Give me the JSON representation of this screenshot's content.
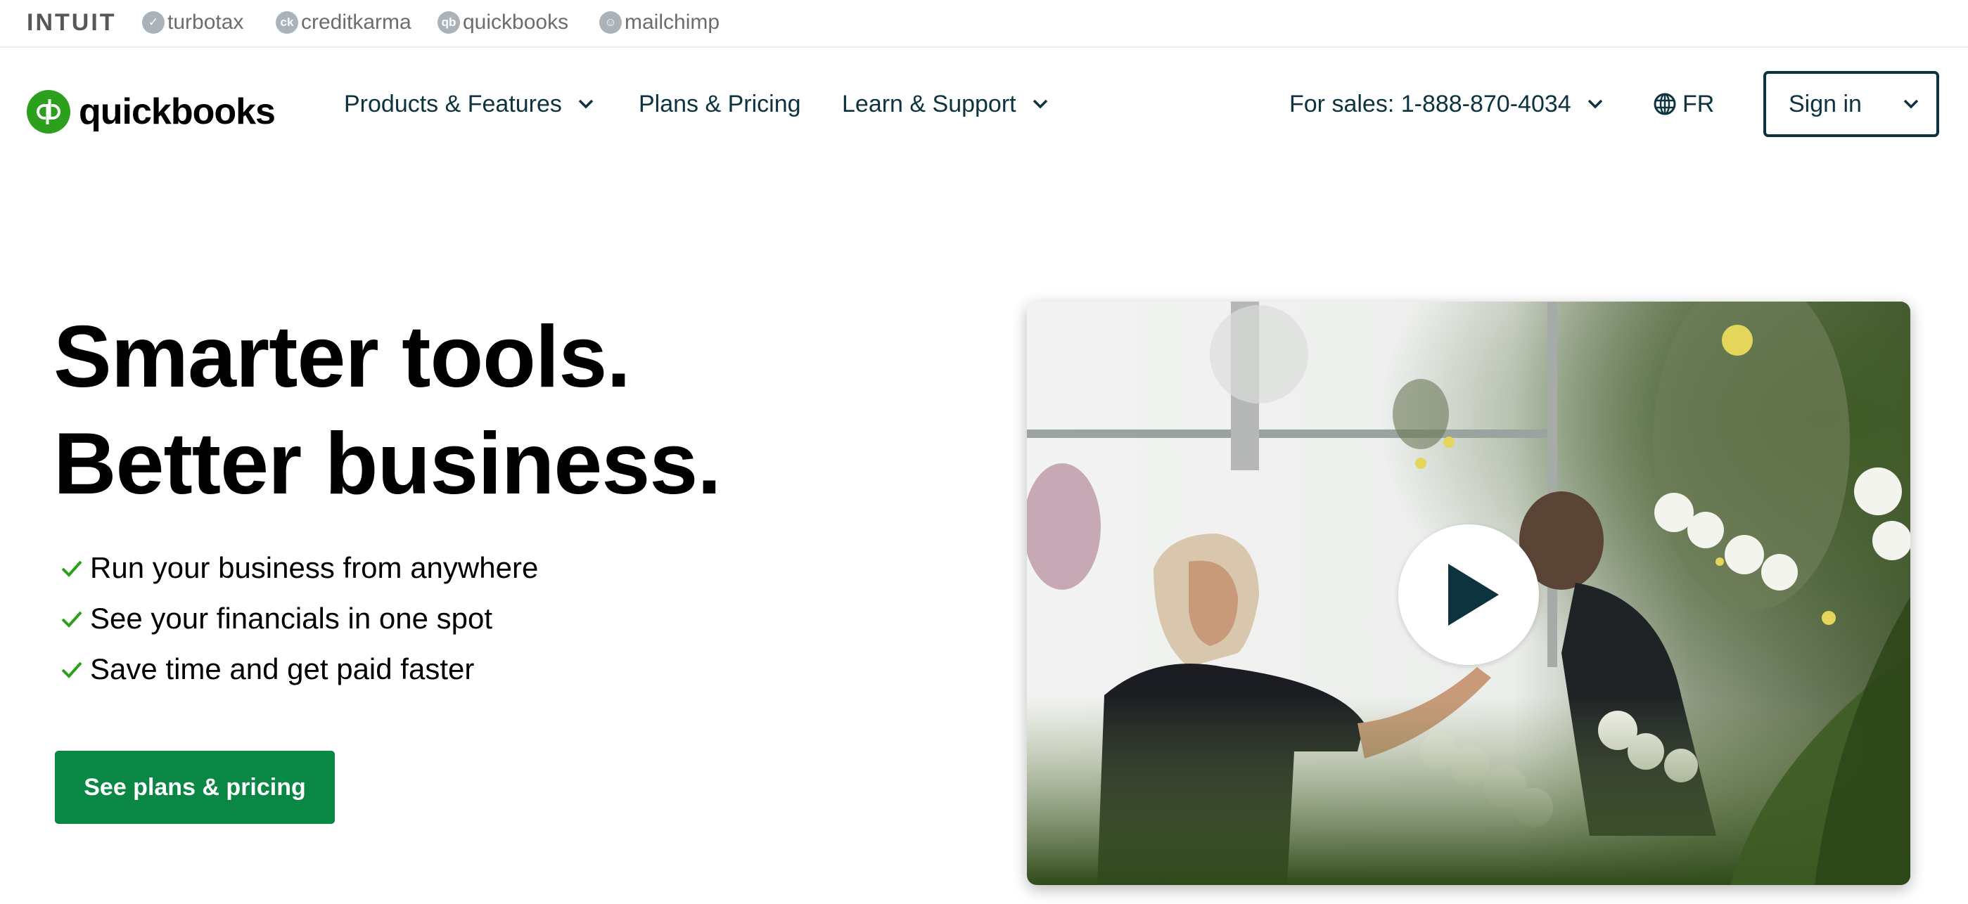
{
  "family_bar": {
    "brand": "INTUIT",
    "items": [
      {
        "label": "turbotax",
        "icon": "turbotax-check-icon",
        "glyph": "✓"
      },
      {
        "label": "creditkarma",
        "icon": "creditkarma-icon",
        "glyph": "ck"
      },
      {
        "label": "quickbooks",
        "icon": "quickbooks-icon",
        "glyph": "qb"
      },
      {
        "label": "mailchimp",
        "icon": "mailchimp-icon",
        "glyph": "☺"
      }
    ]
  },
  "header": {
    "logo_text": "quickbooks",
    "logo_glyph": "qb",
    "nav": [
      {
        "label": "Products & Features",
        "has_dropdown": true
      },
      {
        "label": "Plans & Pricing",
        "has_dropdown": false
      },
      {
        "label": "Learn & Support",
        "has_dropdown": true
      }
    ],
    "sales": {
      "label": "For sales: 1-888-870-4034",
      "has_dropdown": true
    },
    "language": {
      "label": "FR",
      "icon": "globe-icon"
    },
    "sign_in": {
      "label": "Sign in",
      "has_dropdown": true
    }
  },
  "hero": {
    "headline_line1": "Smarter tools.",
    "headline_line2": "Better business.",
    "benefits": [
      "Run your business from anywhere",
      "See your financials in one spot",
      "Save time and get paid faster"
    ],
    "cta_label": "See plans & pricing"
  },
  "video": {
    "description": "Greenhouse scene with two people tending orchids",
    "play_icon": "play-icon"
  },
  "colors": {
    "brand_green": "#2ca01c",
    "cta_green": "#0a8745",
    "text_dark": "#0d333f",
    "check_green": "#2ca01c",
    "family_gray": "#6b6c72"
  }
}
